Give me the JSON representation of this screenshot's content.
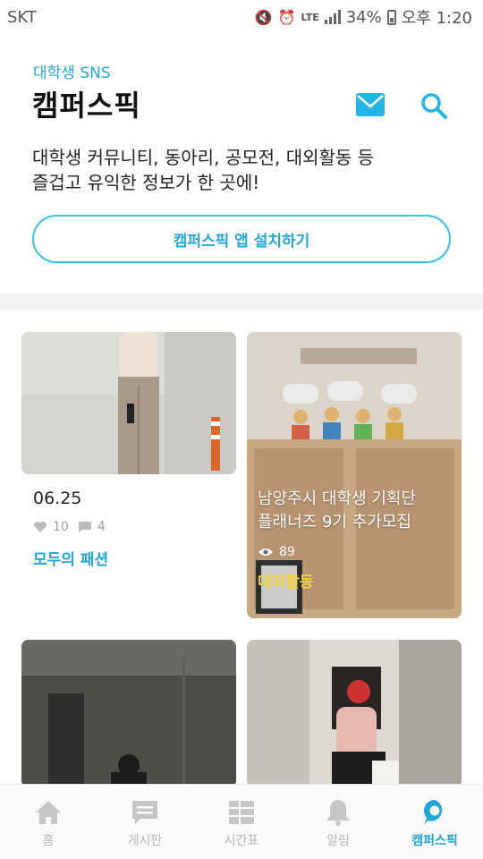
{
  "status_bar": {
    "carrier": "SKT",
    "network": "LTE",
    "battery": "34%",
    "time": "오후 1:20"
  },
  "header": {
    "subtitle": "대학생 SNS",
    "title": "캠퍼스픽",
    "description_line1": "대학생 커뮤니티, 동아리, 공모전, 대외활동 등",
    "description_line2": "즐겁고 유익한 정보가 한 곳에!",
    "install_button": "캠퍼스픽 앱 설치하기"
  },
  "cards": [
    {
      "date": "06.25",
      "likes": "10",
      "comments": "4",
      "category": "모두의 패션"
    },
    {
      "title_line1": "남양주시 대학생 기획단",
      "title_line2": "플래너즈 9기 추가모집",
      "views": "89",
      "category": "대외활동"
    }
  ],
  "nav": [
    {
      "label": "홈",
      "icon": "home-icon"
    },
    {
      "label": "게시판",
      "icon": "board-icon"
    },
    {
      "label": "시간표",
      "icon": "timetable-icon"
    },
    {
      "label": "알림",
      "icon": "bell-icon"
    },
    {
      "label": "캠퍼스픽",
      "icon": "campuspick-icon"
    }
  ],
  "colors": {
    "accent": "#20a6d8",
    "button_border": "#35c2ec",
    "category_yellow": "#f0d23a"
  }
}
